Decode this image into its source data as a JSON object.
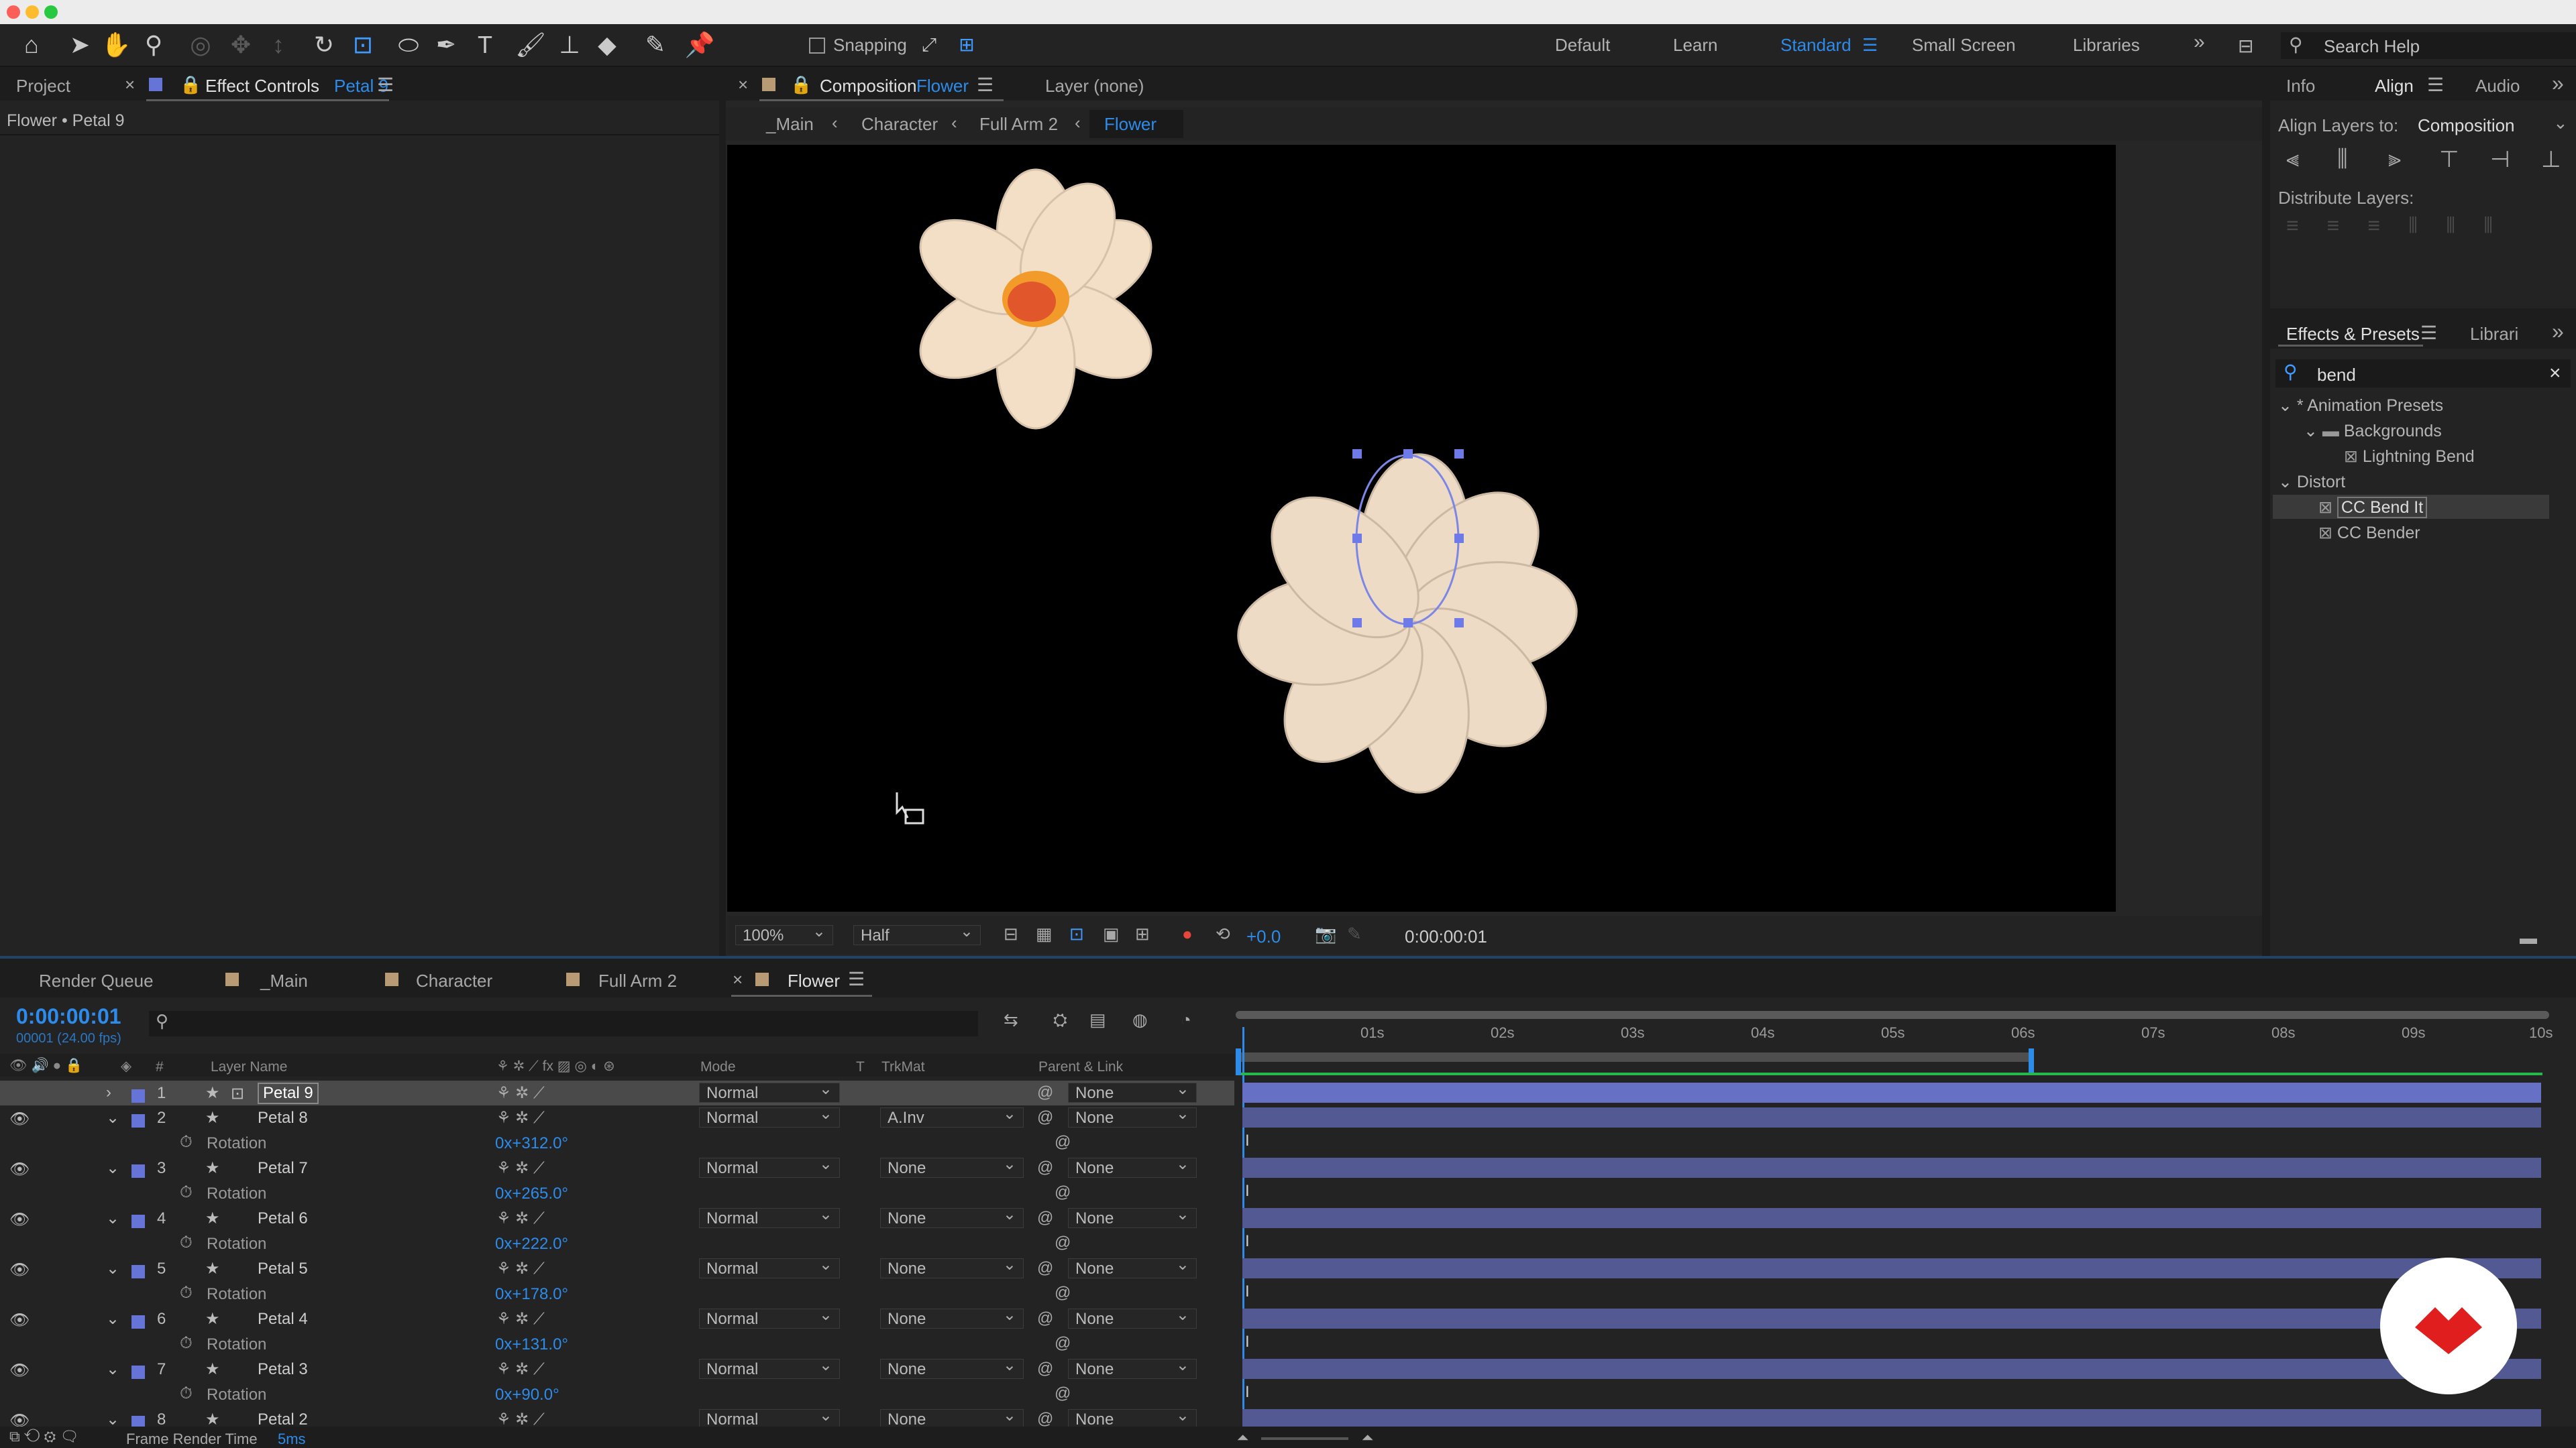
{
  "toolbar": {
    "snapping_label": "Snapping",
    "workspaces": [
      "Default",
      "Learn",
      "Standard",
      "Small Screen",
      "Libraries"
    ],
    "search_placeholder": "Search Help"
  },
  "left_panel": {
    "tab_project": "Project",
    "tab_effect_controls": "Effect Controls",
    "effect_controls_target": "Petal 9",
    "breadcrumb": "Flower • Petal 9"
  },
  "composition": {
    "tab_label": "Composition",
    "tab_name": "Flower",
    "layer_tab": "Layer (none)",
    "nav": [
      "_Main",
      "Character",
      "Full Arm 2",
      "Flower"
    ],
    "zoom": "100%",
    "resolution": "Half",
    "exposure": "+0.0",
    "timecode": "0:00:00:01"
  },
  "right_panel": {
    "tabs": [
      "Info",
      "Align",
      "Audio"
    ],
    "align_layers_to_label": "Align Layers to:",
    "align_layers_to_value": "Composition",
    "distribute_label": "Distribute Layers:",
    "effects_tab": "Effects & Presets",
    "libraries_tab": "Librari",
    "search_value": "bend",
    "tree": [
      {
        "label": "* Animation Presets",
        "level": 0,
        "type": "folder-open"
      },
      {
        "label": "Backgrounds",
        "level": 1,
        "type": "folder"
      },
      {
        "label": "Lightning Bend",
        "level": 2,
        "type": "preset"
      },
      {
        "label": "Distort",
        "level": 0,
        "type": "folder-open"
      },
      {
        "label": "CC Bend It",
        "level": 1,
        "type": "effect",
        "selected": true
      },
      {
        "label": "CC Bender",
        "level": 1,
        "type": "effect"
      }
    ]
  },
  "timeline": {
    "tabs": [
      "Render Queue",
      "_Main",
      "Character",
      "Full Arm 2",
      "Flower"
    ],
    "current_time": "0:00:00:01",
    "frame_info": "00001 (24.00 fps)",
    "columns": {
      "layer_name": "Layer Name",
      "mode": "Mode",
      "t": "T",
      "trkmat": "TrkMat",
      "parent": "Parent & Link"
    },
    "ruler": [
      "01s",
      "02s",
      "03s",
      "04s",
      "05s",
      "06s",
      "07s",
      "08s",
      "09s",
      "10s"
    ],
    "layers": [
      {
        "num": "1",
        "name": "Petal 9",
        "mode": "Normal",
        "trkmat": "",
        "parent": "None",
        "rotation": null
      },
      {
        "num": "2",
        "name": "Petal 8",
        "mode": "Normal",
        "trkmat": "A.Inv",
        "parent": "None",
        "rotation": "0x+312.0°"
      },
      {
        "num": "3",
        "name": "Petal 7",
        "mode": "Normal",
        "trkmat": "None",
        "parent": "None",
        "rotation": "0x+265.0°"
      },
      {
        "num": "4",
        "name": "Petal 6",
        "mode": "Normal",
        "trkmat": "None",
        "parent": "None",
        "rotation": "0x+222.0°"
      },
      {
        "num": "5",
        "name": "Petal 5",
        "mode": "Normal",
        "trkmat": "None",
        "parent": "None",
        "rotation": "0x+178.0°"
      },
      {
        "num": "6",
        "name": "Petal 4",
        "mode": "Normal",
        "trkmat": "None",
        "parent": "None",
        "rotation": "0x+131.0°"
      },
      {
        "num": "7",
        "name": "Petal 3",
        "mode": "Normal",
        "trkmat": "None",
        "parent": "None",
        "rotation": "0x+90.0°"
      },
      {
        "num": "8",
        "name": "Petal 2",
        "mode": "Normal",
        "trkmat": "None",
        "parent": "None",
        "rotation": null
      }
    ],
    "rotation_label": "Rotation",
    "status_label": "Frame Render Time",
    "status_value": "5ms"
  },
  "colors": {
    "accent": "#2d8ceb",
    "layer_label": "#6674d8",
    "bar": "#525993",
    "petal": "#f3dfc6"
  }
}
